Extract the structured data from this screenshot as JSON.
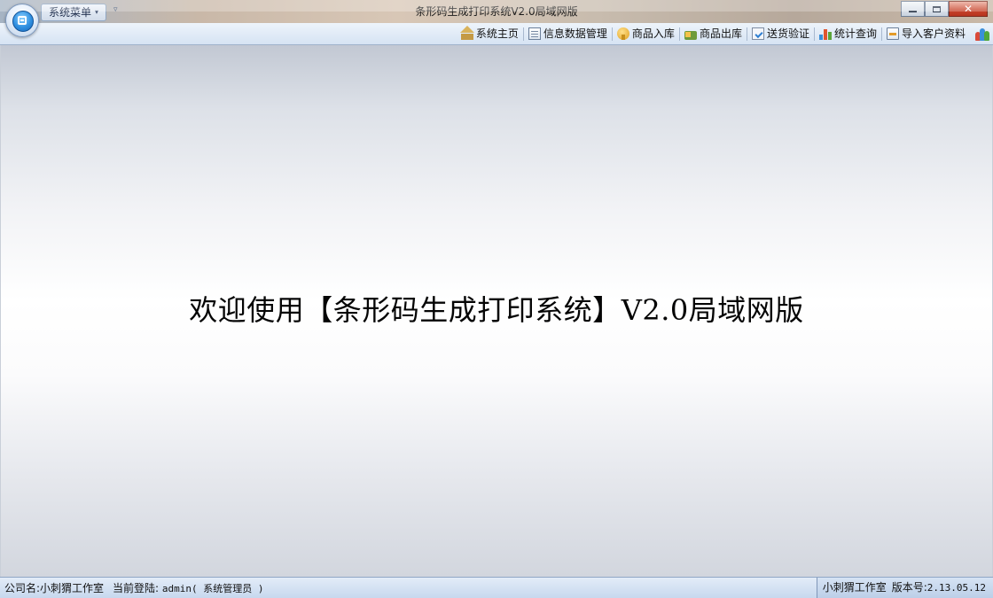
{
  "window": {
    "title": "条形码生成打印系统V2.0局域网版",
    "system_menu_label": "系统菜单",
    "controls": {
      "minimize": "",
      "maximize": "",
      "close": "✕"
    }
  },
  "toolbar": {
    "items": [
      {
        "label": "系统主页",
        "icon": "home-icon"
      },
      {
        "label": "信息数据管理",
        "icon": "data-form-icon"
      },
      {
        "label": "商品入库",
        "icon": "stock-in-icon"
      },
      {
        "label": "商品出库",
        "icon": "stock-out-icon"
      },
      {
        "label": "送货验证",
        "icon": "verify-icon"
      },
      {
        "label": "统计查询",
        "icon": "statistics-icon"
      },
      {
        "label": "导入客户资料",
        "icon": "import-icon"
      }
    ],
    "trailing_icon": "users-icon"
  },
  "main": {
    "welcome_text": "欢迎使用【条形码生成打印系统】V2.0局域网版"
  },
  "status": {
    "company_label": "公司名:小刺猬工作室",
    "login_label": "当前登陆:",
    "login_value": "admin( 系统管理员 )",
    "studio_name": "小刺猬工作室",
    "version_label": "版本号:",
    "version_value": "2.13.05.12"
  },
  "colors": {
    "toolbar_bg": "#dde8f5",
    "statusbar_bg": "#d3e1f3",
    "close_button": "#c8452d",
    "text": "#111111"
  }
}
